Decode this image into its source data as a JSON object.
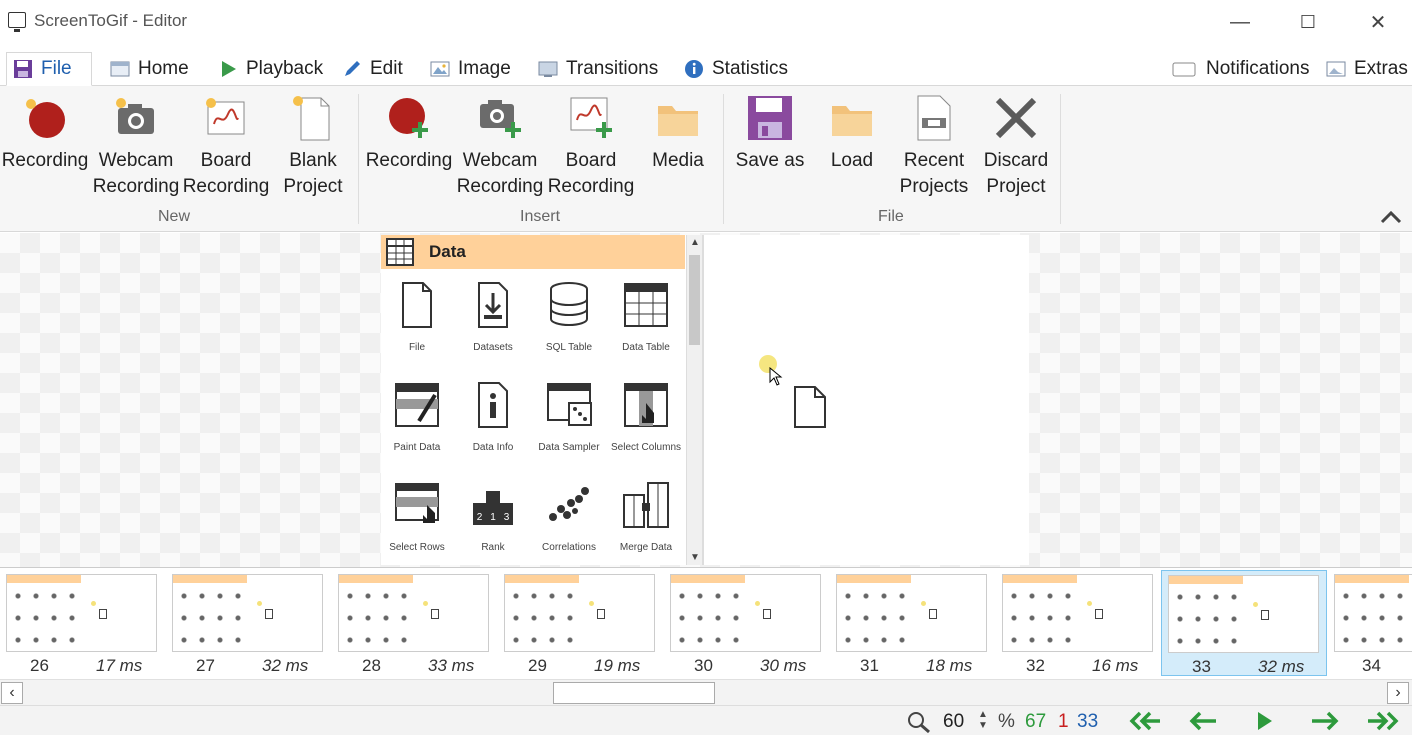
{
  "window": {
    "title": "ScreenToGif - Editor",
    "minimize": "—",
    "maximize": "☐",
    "close": "✕"
  },
  "tabs": [
    {
      "label": "File",
      "icon": "save-icon",
      "active": true
    },
    {
      "label": "Home",
      "icon": "image-icon"
    },
    {
      "label": "Playback",
      "icon": "play-icon"
    },
    {
      "label": "Edit",
      "icon": "pencil-icon"
    },
    {
      "label": "Image",
      "icon": "picture-icon"
    },
    {
      "label": "Transitions",
      "icon": "transitions-icon"
    },
    {
      "label": "Statistics",
      "icon": "info-icon"
    }
  ],
  "top_right": {
    "notifications": "Notifications",
    "extras": "Extras"
  },
  "ribbon": {
    "new": {
      "label": "New",
      "recording": "Recording",
      "webcam_1": "Webcam",
      "webcam_2": "Recording",
      "board_1": "Board",
      "board_2": "Recording",
      "blank_1": "Blank",
      "blank_2": "Project"
    },
    "insert": {
      "label": "Insert",
      "recording": "Recording",
      "webcam_1": "Webcam",
      "webcam_2": "Recording",
      "board_1": "Board",
      "board_2": "Recording",
      "media": "Media"
    },
    "file": {
      "label": "File",
      "save_as": "Save as",
      "load": "Load",
      "recent_1": "Recent",
      "recent_2": "Projects",
      "discard_1": "Discard",
      "discard_2": "Project"
    },
    "collapse": "^"
  },
  "panel": {
    "title": "Data",
    "widgets": [
      {
        "label": "File",
        "icon": "file-icon"
      },
      {
        "label": "Datasets",
        "icon": "datasets-icon"
      },
      {
        "label": "SQL Table",
        "icon": "database-icon"
      },
      {
        "label": "Data Table",
        "icon": "table-icon"
      },
      {
        "label": "Paint Data",
        "icon": "paint-data-icon"
      },
      {
        "label": "Data Info",
        "icon": "info-doc-icon"
      },
      {
        "label": "Data Sampler",
        "icon": "dice-icon"
      },
      {
        "label": "Select Columns",
        "icon": "select-columns-icon"
      },
      {
        "label": "Select Rows",
        "icon": "select-rows-icon"
      },
      {
        "label": "Rank",
        "icon": "podium-icon"
      },
      {
        "label": "Correlations",
        "icon": "scatter-icon"
      },
      {
        "label": "Merge Data",
        "icon": "merge-icon"
      }
    ],
    "rank_digits": [
      "2",
      "1",
      "3"
    ]
  },
  "frames": [
    {
      "num": "26",
      "dur": "17 ms"
    },
    {
      "num": "27",
      "dur": "32 ms"
    },
    {
      "num": "28",
      "dur": "33 ms"
    },
    {
      "num": "29",
      "dur": "19 ms"
    },
    {
      "num": "30",
      "dur": "30 ms"
    },
    {
      "num": "31",
      "dur": "18 ms"
    },
    {
      "num": "32",
      "dur": "16 ms"
    },
    {
      "num": "33",
      "dur": "32 ms",
      "selected": true
    },
    {
      "num": "34",
      "dur": ""
    }
  ],
  "status": {
    "zoom": "60",
    "percent": "%",
    "total_frames": "67",
    "selected_count": "1",
    "current_frame": "33"
  },
  "colors": {
    "accent": "#1f5fae",
    "panel_header": "#ffd19a",
    "record_red": "#b0201c",
    "save_purple": "#8a4a9e",
    "nav_green": "#2d9a3c",
    "count_green": "#2d9a3c",
    "count_red": "#c81e1e",
    "count_blue": "#1f5fae"
  }
}
